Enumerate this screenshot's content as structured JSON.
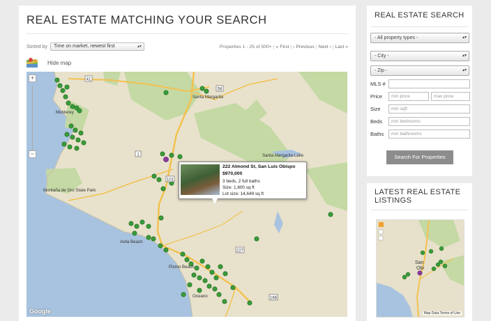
{
  "main": {
    "title": "REAL ESTATE MATCHING YOUR SEARCH",
    "sorted_by_label": "Sorted by",
    "sort_value": "Time on market, newest first",
    "pager": {
      "summary": "Properties 1 - 25 of 500+",
      "first": "« First",
      "previous": "‹ Previous",
      "next": "Next ›",
      "last": "Last »"
    },
    "hide_map_label": "Hide map"
  },
  "map": {
    "town_labels": [
      "Monterey",
      "Santa Margarita",
      "Santa Margarita Lake",
      "Montaña de Oro State Park",
      "Avila Beach",
      "Pismo Beach",
      "Oceano"
    ],
    "road_shields": [
      "1",
      "41",
      "58",
      "101",
      "227",
      "166"
    ],
    "google_logo": "Google",
    "zoom_in": "+",
    "zoom_out": "−",
    "colors": {
      "water": "#a8c3df",
      "land": "#e8e2cc",
      "park": "#c4d9a4",
      "pin": "#3a9b3a",
      "pin_selected": "#8a3c9a",
      "highway": "#f3c14f"
    }
  },
  "popup": {
    "address": "222 Almond St, San Luis Obispo",
    "price": "$970,000",
    "beds_baths": "3 beds, 2 full baths",
    "size": "Size: 1,600 sq ft",
    "lot_size": "Lot size: 14,649 sq ft"
  },
  "search_panel": {
    "title": "REAL ESTATE SEARCH",
    "property_type": "- All property types -",
    "city": "- City -",
    "zip": "- Zip -",
    "mls_label": "MLS #",
    "price_label": "Price",
    "min_price_placeholder": "min price",
    "max_price_placeholder": "max price",
    "size_label": "Size",
    "size_placeholder": "min sqft",
    "beds_label": "Beds",
    "beds_placeholder": "min bedrooms",
    "baths_label": "Baths",
    "baths_placeholder": "min bathrooms",
    "search_button": "Search For Properties"
  },
  "latest_panel": {
    "title": "LATEST REAL ESTATE LISTINGS",
    "minimap_labels": [
      "San",
      "Obi"
    ],
    "credits": "Map Data   Terms of Use"
  }
}
